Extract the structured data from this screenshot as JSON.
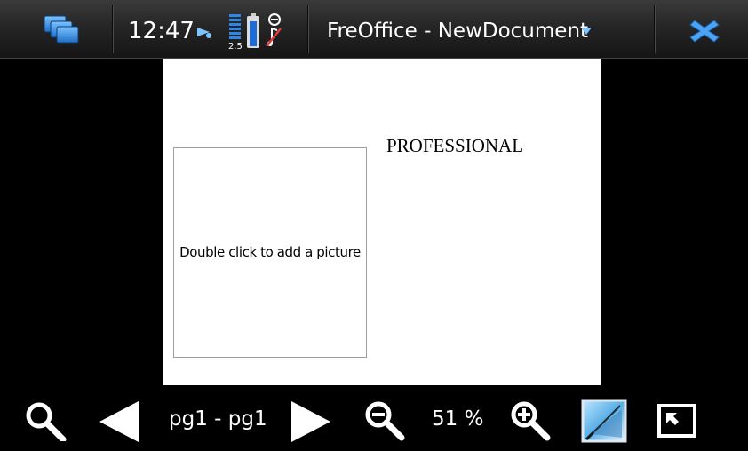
{
  "status_bar": {
    "time": "12:47",
    "status_text": "2.5",
    "app_title": "FreOffice - NewDocument"
  },
  "document": {
    "picture_placeholder": "Double click to add a picture",
    "heading": "PROFESSIONAL"
  },
  "toolbar": {
    "page_range": "pg1 - pg1",
    "zoom": "51 %"
  },
  "colors": {
    "accent": "#3a8fe0",
    "page": "#ffffff",
    "background": "#000000"
  }
}
